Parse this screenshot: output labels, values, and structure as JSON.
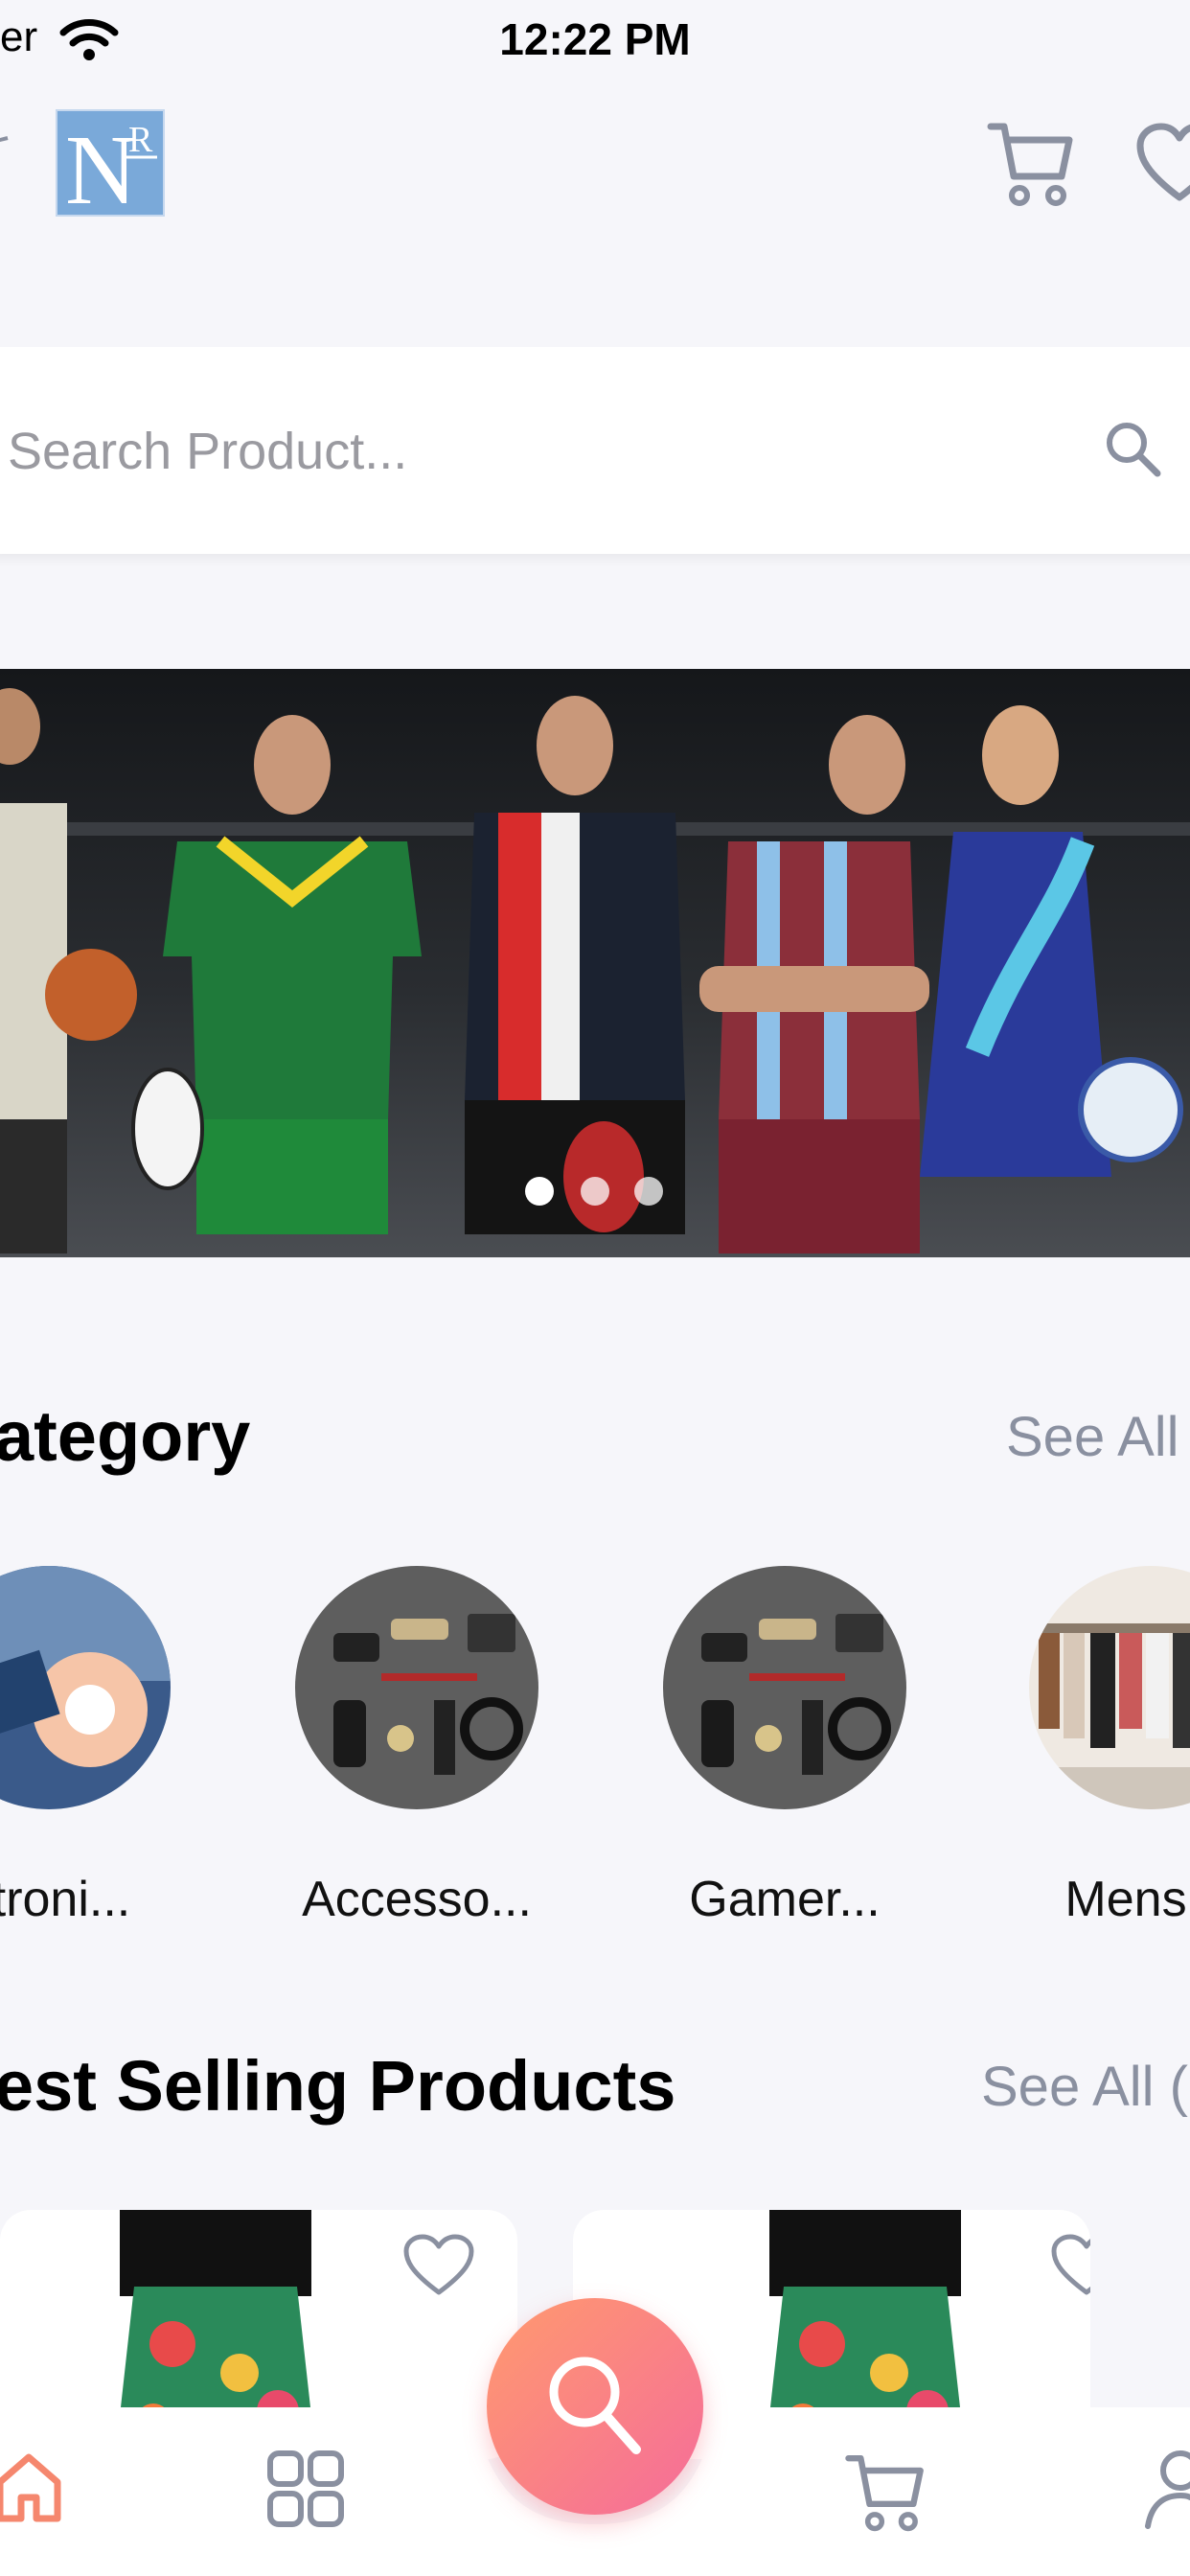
{
  "status_bar": {
    "carrier": "er",
    "time": "12:22 PM"
  },
  "header": {
    "logo_text": "N",
    "logo_superscript": "R"
  },
  "search": {
    "placeholder": "Search Product..."
  },
  "banner": {
    "slide_count": 3,
    "active_slide": 1
  },
  "category_section": {
    "title": "ategory",
    "see_all": "See All",
    "items": [
      {
        "label": "ctroni..."
      },
      {
        "label": "Accesso..."
      },
      {
        "label": "Gamer..."
      },
      {
        "label": "Mens C"
      }
    ]
  },
  "best_selling": {
    "title": "est Selling Products",
    "see_all": "See All ("
  },
  "colors": {
    "accent": "#f56c9a",
    "accent_start": "#ff9a6e",
    "icon_gray": "#8a90a0",
    "active_nav": "#f5876e",
    "logo_bg": "#7aa9d9"
  },
  "bottom_nav": {
    "items": [
      {
        "icon": "home-icon",
        "active": true
      },
      {
        "icon": "grid-icon",
        "active": false
      },
      {
        "icon": "search-icon",
        "active": false
      },
      {
        "icon": "cart-icon",
        "active": false
      },
      {
        "icon": "profile-icon",
        "active": false
      }
    ]
  }
}
